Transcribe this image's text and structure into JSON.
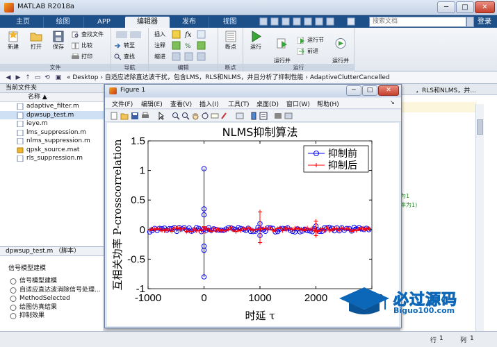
{
  "window": {
    "title": "MATLAB R2018a"
  },
  "tabs": [
    "主页",
    "绘图",
    "APP",
    "编辑器",
    "发布",
    "视图"
  ],
  "search": {
    "placeholder": "搜索文档"
  },
  "login_label": "登录",
  "ribbon": {
    "file": {
      "label": "文件",
      "new": "新建",
      "open": "打开",
      "save": "保存",
      "find_files": "查找文件",
      "compare": "比较",
      "print": "打印"
    },
    "navigate": {
      "label": "导航",
      "goto": "转至",
      "find": "查找"
    },
    "edit": {
      "label": "编辑",
      "insert": "插入",
      "comment": "注释",
      "indent": "缩进"
    },
    "breakpoint": {
      "label": "断点",
      "breakpoints": "断点"
    },
    "run": {
      "label": "运行",
      "run": "运行",
      "run_advance": "运行并\n前进",
      "run_section": "运行节",
      "advance": "前进",
      "run_time": "运行并\n计时"
    }
  },
  "address": {
    "path": "« Desktop › 自适应滤除直达波干扰，包含LMS，RLS和NLMS，并且分析了抑制性能 › AdaptiveClutterCancelled"
  },
  "current_folder": {
    "header": "当前文件夹",
    "column": "名称 ▲",
    "files": [
      {
        "name": "adaptive_filter.m",
        "selected": false
      },
      {
        "name": "dpwsup_test.m",
        "selected": true
      },
      {
        "name": "ieye.m",
        "selected": false
      },
      {
        "name": "lms_suppression.m",
        "selected": false
      },
      {
        "name": "nlms_suppression.m",
        "selected": false
      },
      {
        "name": "qpsk_source.mat",
        "selected": false
      },
      {
        "name": "rls_suppression.m",
        "selected": false
      }
    ]
  },
  "details": {
    "header": "dpwsup_test.m （脚本）",
    "title": "信号模型建模",
    "items": [
      "信号模型建模",
      "自适应直达波消除信号处理...",
      "MethodSelected",
      "绘图仿真结果",
      "抑制效果"
    ]
  },
  "editor": {
    "tab_text": "，RLS和NLMS，并...",
    "comment1": "为1",
    "comment2": "率为1)"
  },
  "status": {
    "row_label": "行",
    "row": "1",
    "col_label": "列",
    "col": "1"
  },
  "figure": {
    "title": "Figure 1",
    "menu": [
      "文件(F)",
      "编辑(E)",
      "查看(V)",
      "插入(I)",
      "工具(T)",
      "桌面(D)",
      "窗口(W)",
      "帮助(H)"
    ]
  },
  "chart_data": {
    "type": "line",
    "title": "NLMS抑制算法",
    "xlabel": "时延 τ",
    "ylabel": "互相关功率 P-crosscorrelation",
    "xlim": [
      -1000,
      3000
    ],
    "ylim": [
      -1,
      1.5
    ],
    "xticks": [
      -1000,
      0,
      1000,
      2000,
      3000
    ],
    "yticks": [
      -1,
      -0.5,
      0,
      0.5,
      1,
      1.5
    ],
    "legend_position": "top-right",
    "series": [
      {
        "name": "抑制前",
        "color": "#0000ff",
        "marker": "o",
        "peaks": [
          [
            0,
            1.03
          ],
          [
            0,
            -0.8
          ],
          [
            0,
            0.35
          ],
          [
            0,
            -0.35
          ],
          [
            0,
            0.25
          ],
          [
            0,
            -0.28
          ],
          [
            1000,
            0.1
          ],
          [
            1000,
            -0.1
          ],
          [
            2000,
            0.06
          ]
        ],
        "noise_amplitude": 0.04
      },
      {
        "name": "抑制后",
        "color": "#ff0000",
        "marker": "+",
        "peaks": [
          [
            0,
            0.05
          ],
          [
            0,
            -0.06
          ],
          [
            1000,
            0.3
          ],
          [
            1000,
            -0.22
          ],
          [
            2000,
            0.14
          ],
          [
            2000,
            -0.1
          ]
        ],
        "noise_amplitude": 0.035
      }
    ]
  },
  "watermark": {
    "cn": "必过源码",
    "en": "Biguo100.com"
  }
}
